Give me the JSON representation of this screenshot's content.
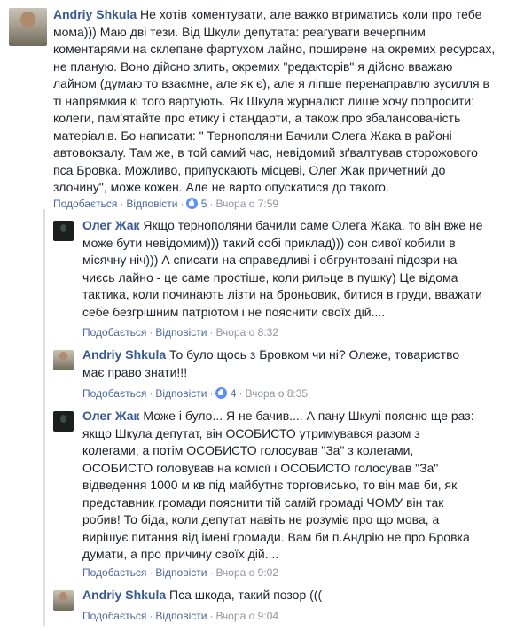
{
  "comments": [
    {
      "author": "Andriy Shkula",
      "text": " Не хотів коментувати, але важко втриматись коли про тебе\nмома))) Маю дві тези. Від Шкули депутата: реагувати вечерпним\nкоментарями на склепане фартухом лайно, поширене на окремих ресурсах,\nне планую. Воно дійсно злить, окремих \"редакторів\" я дійсно вважаю\nлайном (думаю то взаємне, але як є), але я ліпше перенаправлю зусилля в\nті напрямкия кі того вартують. Як Шкула журналіст лише хочу попросити:\nколеги, пам'ятайте про етику і стандарти, а також про збалансованість\nматеріалів. Бо написати: \" Тернополяни Бачили Олега Жака в районі\nавтовокзалу. Там же, в той самий час, невідомий зґвалтував сторожового\nпса Бровка. Можливо, припускають місцеві, Олег Жак причетний до\nзлочину\", може кожен. Але не варто опускатися до такого.",
      "like_label": "Подобається",
      "reply_label": "Відповісти",
      "likes": "5",
      "time": "Вчора о 7:59"
    },
    {
      "author": "Олег Жак",
      "text": " Якщо тернополяни бачили саме Олега Жака, то він вже не\nможе бути невідомим))) такий собі приклад))) сон сивої кобили в\nмісячну ніч))) А списати на справедливі і обгрунтовані підозри на\nчиєсь лайно - це саме простіше, коли рильце в пушку) Це відома\nтактика, коли починають лізти на броньовик, битися в груди, вважати\nсебе безгрішним патріотом і не пояснити своїх дій....",
      "like_label": "Подобається",
      "reply_label": "Відповісти",
      "time": "Вчора о 8:32"
    },
    {
      "author": "Andriy Shkula",
      "text": " То було щось з Бровком чи ні? Олеже, товариство\nмає право знати!!!",
      "like_label": "Подобається",
      "reply_label": "Відповісти",
      "likes": "4",
      "time": "Вчора о 8:35"
    },
    {
      "author": "Олег Жак",
      "text": " Може і було... Я не бачив.... А пану Шкулі поясню ще раз:\nякщо Шкула депутат, він ОСОБИСТО утримувався разом з\nколегами, а потім ОСОБИСТО голосував \"За\" з колегами,\nОСОБИСТО головував на комісії і ОСОБИСТО голосував \"За\"\nвідведення 1000 м кв під майбутнє торговисько, то він мав би, як\nпредставник громади пояснити тій самій громаді ЧОМУ він так\nробив! То біда, коли депутат навіть не розуміє про що мова, а\nвирішує питання від імені громади. Вам би п.Андрію не про Бровка\nдумати, а про причину своїх дій....",
      "like_label": "Подобається",
      "reply_label": "Відповісти",
      "time": "Вчора о 9:02"
    },
    {
      "author": "Andriy Shkula",
      "text": " Пса шкода, такий позор (((",
      "like_label": "Подобається",
      "reply_label": "Відповісти",
      "time": "Вчора о 9:04"
    }
  ],
  "colors": {
    "author": "#365899",
    "action_link": "#4b67a1",
    "meta": "#90949c",
    "like_badge": "#5890ff"
  },
  "icons": {
    "like_badge": "thumbs-up-icon"
  }
}
